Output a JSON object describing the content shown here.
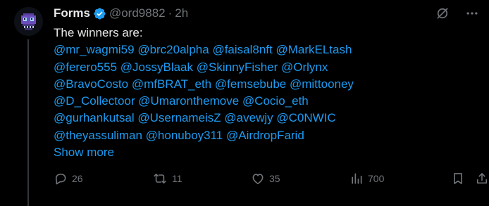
{
  "post": {
    "author_name": "Forms",
    "handle": "@ord9882",
    "separator": "·",
    "time": "2h",
    "intro": "The winners are:",
    "mention_lines": [
      [
        "@mr_wagmi59",
        "@brc20alpha",
        "@faisal8nft",
        "@MarkELtash"
      ],
      [
        "@ferero555",
        "@JossyBlaak",
        "@SkinnyFisher",
        "@Orlynx"
      ],
      [
        "@BravoCosto",
        "@mfBRAT_eth",
        "@femsebube",
        "@mittooney"
      ],
      [
        "@D_Collectoor",
        "@Umaronthemove",
        "@Cocio_eth"
      ],
      [
        "@gurhankutsal",
        "@UsernameisZ",
        "@avewjy",
        "@C0NWIC"
      ],
      [
        "@theyassuliman",
        "@honuboy311",
        "@AirdropFarid"
      ]
    ],
    "show_more": "Show more"
  },
  "actions": {
    "replies": "26",
    "reposts": "11",
    "likes": "35",
    "views": "700"
  },
  "icons": {
    "verified": "verified-badge-icon",
    "grok": "grok-icon",
    "more": "more-icon",
    "reply": "reply-icon",
    "repost": "repost-icon",
    "like": "heart-icon",
    "views": "views-icon",
    "bookmark": "bookmark-icon",
    "share": "share-icon"
  },
  "colors": {
    "background": "#000000",
    "text": "#e7e9ea",
    "muted": "#71767b",
    "link": "#1d9bf0",
    "verified": "#1d9bf0"
  }
}
